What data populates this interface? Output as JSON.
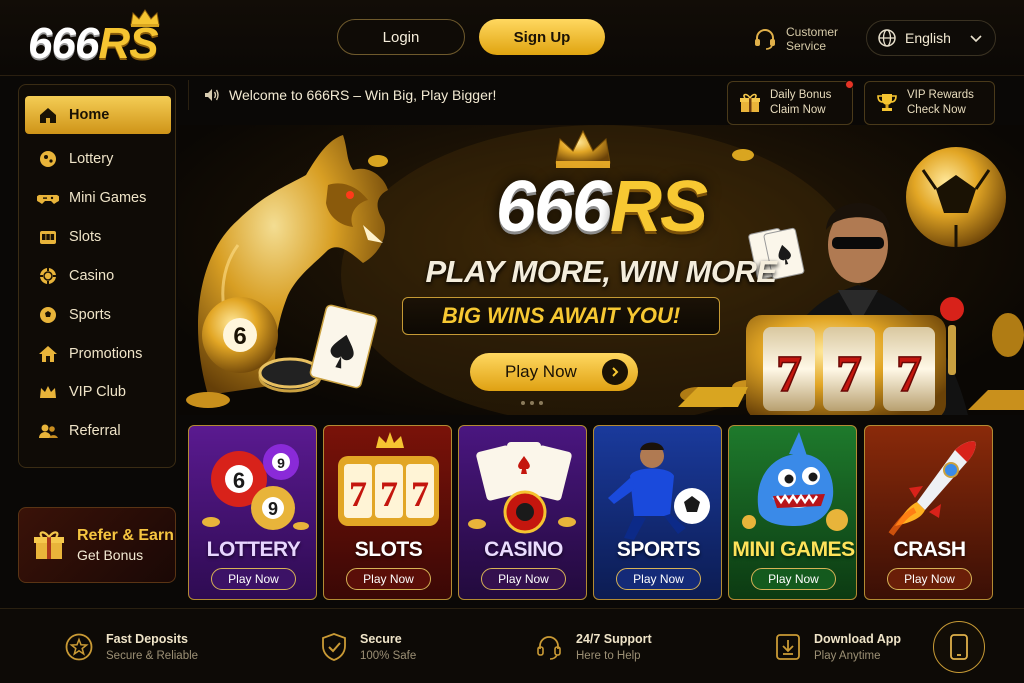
{
  "header": {
    "logo_white": "666",
    "logo_gold": "RS",
    "login_label": "Login",
    "signup_label": "Sign Up",
    "customer_service_line1": "Customer",
    "customer_service_line2": "Service",
    "language": "English"
  },
  "sidebar": {
    "items": [
      {
        "label": "Home",
        "icon": "home-icon",
        "active": true
      },
      {
        "label": "Lottery",
        "icon": "lottery-ball-icon"
      },
      {
        "label": "Mini Games",
        "icon": "gamepad-icon"
      },
      {
        "label": "Slots",
        "icon": "slot-machine-icon"
      },
      {
        "label": "Casino",
        "icon": "chip-icon"
      },
      {
        "label": "Sports",
        "icon": "soccer-ball-icon"
      },
      {
        "label": "Promotions",
        "icon": "house-promo-icon"
      },
      {
        "label": "VIP Club",
        "icon": "crown-icon"
      },
      {
        "label": "Referral",
        "icon": "users-icon"
      }
    ],
    "refer_title": "Refer & Earn",
    "refer_sub": "Get Bonus"
  },
  "ticker": {
    "text": "Welcome to 666RS – Win Big, Play Bigger!"
  },
  "promos": {
    "daily_line1": "Daily Bonus",
    "daily_line2": "Claim Now",
    "vip_line1": "VIP Rewards",
    "vip_line2": "Check Now"
  },
  "hero": {
    "title_white": "666",
    "title_gold": "RS",
    "subtitle": "PLAY MORE, WIN MORE",
    "tagline": "BIG WINS AWAIT YOU!",
    "cta": "Play Now",
    "ball_number": "6",
    "slot_symbols": [
      "7",
      "7",
      "7"
    ]
  },
  "games": [
    {
      "name": "LOTTERY",
      "cta": "Play Now",
      "balls": [
        "6",
        "9",
        "9"
      ]
    },
    {
      "name": "SLOTS",
      "cta": "Play Now",
      "reels": [
        "7",
        "7",
        "7"
      ]
    },
    {
      "name": "CASINO",
      "cta": "Play Now"
    },
    {
      "name": "SPORTS",
      "cta": "Play Now"
    },
    {
      "name": "MINI GAMES",
      "cta": "Play Now"
    },
    {
      "name": "CRASH",
      "cta": "Play Now"
    }
  ],
  "footer": {
    "features": [
      {
        "title": "Fast Deposits",
        "sub": "Secure & Reliable",
        "icon": "star-badge-icon"
      },
      {
        "title": "Secure",
        "sub": "100% Safe",
        "icon": "shield-check-icon"
      },
      {
        "title": "24/7 Support",
        "sub": "Here to Help",
        "icon": "headset-icon"
      },
      {
        "title": "Download App",
        "sub": "Play Anytime",
        "icon": "download-icon"
      }
    ]
  },
  "colors": {
    "gold": "#f5c431",
    "background": "#0a0806",
    "accent_dark": "#1a1204"
  }
}
